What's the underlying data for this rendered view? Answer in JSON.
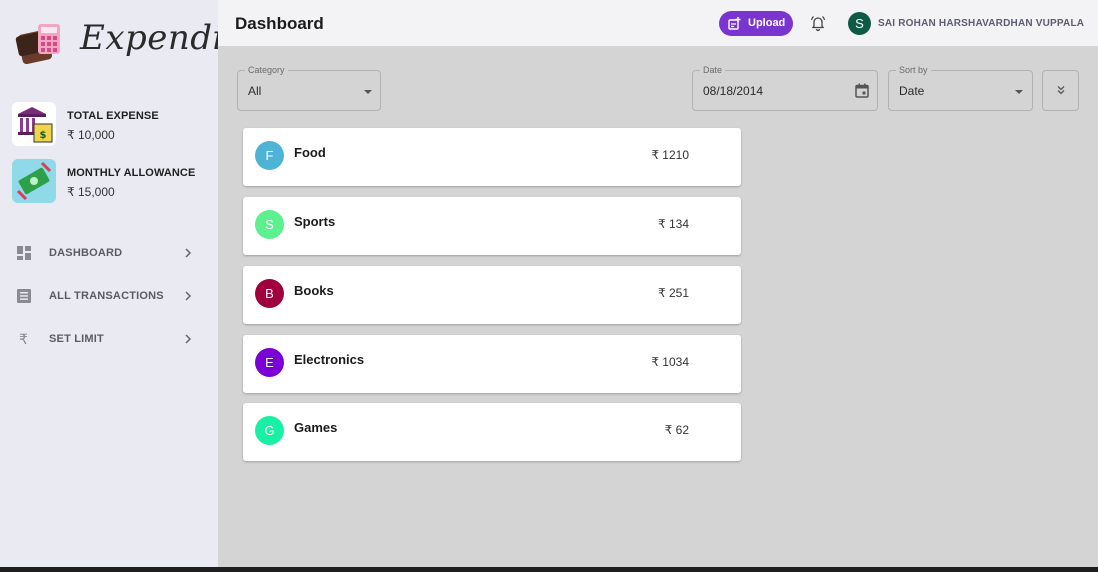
{
  "app": {
    "logo_text": "Expendio"
  },
  "stats": [
    {
      "label": "TOTAL EXPENSE",
      "value": "₹ 10,000"
    },
    {
      "label": "MONTHLY ALLOWANCE",
      "value": "₹ 15,000"
    }
  ],
  "nav": [
    {
      "label": "DASHBOARD",
      "icon": "dashboard-icon"
    },
    {
      "label": "ALL TRANSACTIONS",
      "icon": "list-icon"
    },
    {
      "label": "SET LIMIT",
      "icon": "rupee-icon"
    }
  ],
  "header": {
    "title": "Dashboard",
    "upload_label": "Upload",
    "user_initial": "S",
    "user_name": "SAI ROHAN HARSHAVARDHAN VUPPALA"
  },
  "filters": {
    "category": {
      "label": "Category",
      "value": "All"
    },
    "date": {
      "label": "Date",
      "value": "08/18/2014"
    },
    "sort": {
      "label": "Sort by",
      "value": "Date"
    }
  },
  "categories": [
    {
      "initial": "F",
      "name": "Food",
      "amount": "₹ 1210",
      "color": "#4fb3d6"
    },
    {
      "initial": "S",
      "name": "Sports",
      "amount": "₹ 134",
      "color": "#5cf08f"
    },
    {
      "initial": "B",
      "name": "Books",
      "amount": "₹ 251",
      "color": "#a0003b"
    },
    {
      "initial": "E",
      "name": "Electronics",
      "amount": "₹ 1034",
      "color": "#7a00d6"
    },
    {
      "initial": "G",
      "name": "Games",
      "amount": "₹ 62",
      "color": "#18f0a4"
    }
  ],
  "colors": {
    "accent": "#7a35d1",
    "sidebar": "#eaeaf2",
    "main_bg": "#d4d4d4"
  }
}
